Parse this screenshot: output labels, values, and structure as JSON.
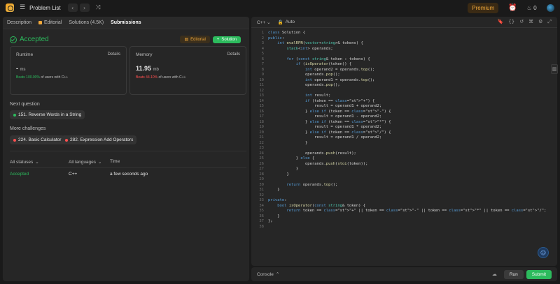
{
  "topbar": {
    "title": "Problem List",
    "premium": "Premium",
    "streak": "0",
    "icons": [
      "logo-icon",
      "list-icon",
      "prev-icon",
      "next-icon",
      "shuffle-icon",
      "alarm-icon",
      "flame-icon",
      "avatar"
    ]
  },
  "tabs": [
    {
      "label": "Description"
    },
    {
      "label": "Editorial"
    },
    {
      "label": "Solutions (4.5K)"
    },
    {
      "label": "Submissions"
    }
  ],
  "submission": {
    "status": "Accepted",
    "editorial_btn": "Editorial",
    "solution_btn": "Solution",
    "runtime": {
      "label": "Runtime",
      "details": "Details",
      "value": "-",
      "unit": "ms",
      "beats": "Beats 100.00%",
      "suffix": "of users with C++"
    },
    "memory": {
      "label": "Memory",
      "details": "Details",
      "value": "11.95",
      "unit": "mb",
      "beats": "Beats 44.10%",
      "suffix": "of users with C++"
    }
  },
  "next_question": {
    "label": "Next question",
    "item": "151. Reverse Words in a String"
  },
  "more_challenges": {
    "label": "More challenges",
    "items": [
      "224. Basic Calculator",
      "282. Expression Add Operators"
    ]
  },
  "table": {
    "filters": [
      "All statuses",
      "All languages",
      "Time"
    ],
    "rows": [
      {
        "status": "Accepted",
        "language": "C++",
        "time": "a few seconds ago"
      }
    ]
  },
  "editor": {
    "language": "C++",
    "autocomplete": "Auto",
    "lines": [
      "class Solution {",
      "public:",
      "    int evalRPN(vector<string>& tokens) {",
      "        stack<int> operands;",
      "",
      "        for (const string& token : tokens) {",
      "            if (isOperator(token)) {",
      "                int operand2 = operands.top();",
      "                operands.pop();",
      "                int operand1 = operands.top();",
      "                operands.pop();",
      "",
      "                int result;",
      "                if (token == \"+\") {",
      "                    result = operand1 + operand2;",
      "                } else if (token == \"-\") {",
      "                    result = operand1 - operand2;",
      "                } else if (token == \"*\") {",
      "                    result = operand1 * operand2;",
      "                } else if (token == \"/\") {",
      "                    result = operand1 / operand2;",
      "                }",
      "",
      "                operands.push(result);",
      "            } else {",
      "                operands.push(stoi(token));",
      "            }",
      "        }",
      "",
      "        return operands.top();",
      "    }",
      "",
      "private:",
      "    bool isOperator(const string& token) {",
      "        return token == \"+\" || token == \"-\" || token == \"*\" || token == \"/\";",
      "    }",
      "};",
      ""
    ]
  },
  "console": {
    "label": "Console",
    "run": "Run",
    "submit": "Submit"
  },
  "colors": {
    "accent_green": "#2cbb5d",
    "premium": "#f2a93b",
    "bg": "#1a1a1a",
    "panel": "#262626"
  }
}
